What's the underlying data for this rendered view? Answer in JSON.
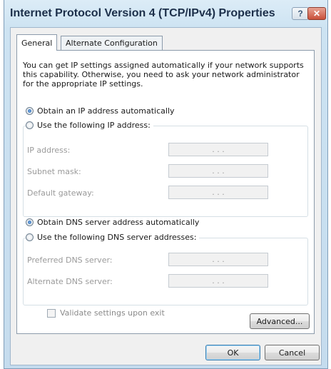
{
  "window": {
    "title": "Internet Protocol Version 4 (TCP/IPv4) Properties",
    "help_glyph": "?",
    "close_glyph": "✕"
  },
  "tabs": [
    {
      "label": "General",
      "active": true
    },
    {
      "label": "Alternate Configuration",
      "active": false
    }
  ],
  "general": {
    "description": "You can get IP settings assigned automatically if your network supports this capability. Otherwise, you need to ask your network administrator for the appropriate IP settings.",
    "ip_options": {
      "auto_label": "Obtain an IP address automatically",
      "manual_label": "Use the following IP address:",
      "selected": "auto"
    },
    "ip_fields": [
      {
        "label": "IP address:",
        "value": ". . ."
      },
      {
        "label": "Subnet mask:",
        "value": ". . ."
      },
      {
        "label": "Default gateway:",
        "value": ". . ."
      }
    ],
    "dns_options": {
      "auto_label": "Obtain DNS server address automatically",
      "manual_label": "Use the following DNS server addresses:",
      "selected": "auto"
    },
    "dns_fields": [
      {
        "label": "Preferred DNS server:",
        "value": ". . ."
      },
      {
        "label": "Alternate DNS server:",
        "value": ". . ."
      }
    ],
    "validate_label": "Validate settings upon exit",
    "validate_checked": false,
    "advanced_label": "Advanced..."
  },
  "footer": {
    "ok_label": "OK",
    "cancel_label": "Cancel"
  }
}
